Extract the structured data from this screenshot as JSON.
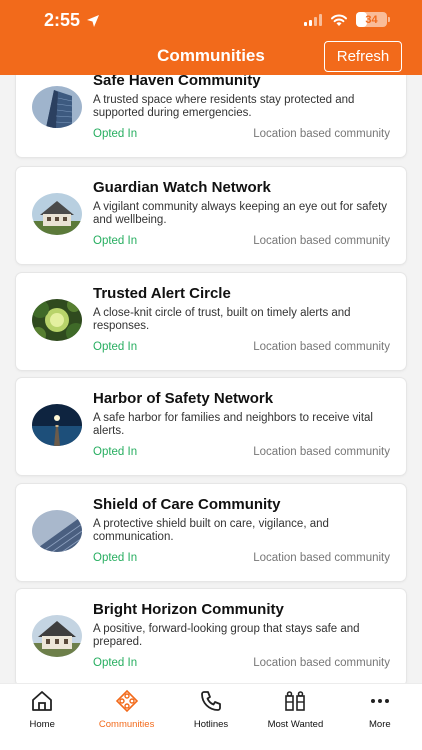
{
  "status_bar": {
    "time": "2:55",
    "battery": "34",
    "battery_level": 0.34
  },
  "header": {
    "title": "Communities",
    "refresh_label": "Refresh"
  },
  "communities": [
    {
      "title": "Safe Haven Community",
      "description": "A trusted space where residents stay protected and supported during emergencies.",
      "status": "Opted In",
      "type": "Location based community",
      "image": "skyscraper-image"
    },
    {
      "title": "Guardian Watch Network",
      "description": "A vigilant community always keeping an eye out for safety and wellbeing.",
      "status": "Opted In",
      "type": "Location based community",
      "image": "chalet-image"
    },
    {
      "title": "Trusted Alert Circle",
      "description": "A close-knit circle of trust, built on timely alerts and responses.",
      "status": "Opted In",
      "type": "Location based community",
      "image": "forest-image"
    },
    {
      "title": "Harbor of Safety Network",
      "description": "A safe harbor for families and neighbors to receive vital alerts.",
      "status": "Opted In",
      "type": "Location based community",
      "image": "pier-image"
    },
    {
      "title": "Shield of Care Community",
      "description": "A protective shield built on care, vigilance, and communication.",
      "status": "Opted In",
      "type": "Location based community",
      "image": "building-facade-image"
    },
    {
      "title": "Bright Horizon Community",
      "description": "A positive, forward-looking group that stays safe and prepared.",
      "status": "Opted In",
      "type": "Location based community",
      "image": "chalet-image"
    }
  ],
  "nav": [
    {
      "label": "Home",
      "icon": "home-icon"
    },
    {
      "label": "Communities",
      "icon": "communities-icon",
      "active": true
    },
    {
      "label": "Hotlines",
      "icon": "phone-icon"
    },
    {
      "label": "Most Wanted",
      "icon": "most-wanted-icon"
    },
    {
      "label": "More",
      "icon": "more-icon"
    }
  ],
  "colors": {
    "accent": "#f26a1b",
    "opted": "#27ae60",
    "muted": "#777777"
  }
}
